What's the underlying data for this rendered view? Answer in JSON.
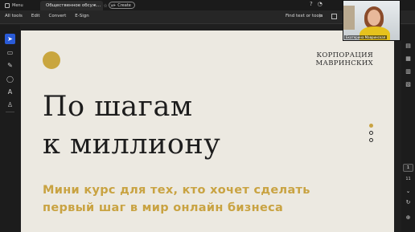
{
  "tabbar": {
    "home_label": "Menu",
    "tab_title": "Общественное обсуж…",
    "tab_close": "×",
    "tab_star": "☆",
    "create_label": "Create",
    "create_plus": "+"
  },
  "menubar": {
    "items": [
      "All tools",
      "Edit",
      "Convert",
      "E-Sign"
    ],
    "find_label": "Find text or tools"
  },
  "document": {
    "corp_line1": "КОРПОРАЦИЯ",
    "corp_line2": "МАВРИНСКИХ",
    "title_line1": "По шагам",
    "title_line2": "к миллиону",
    "subtitle_line1": "Мини курс для тех, кто хочет сделать",
    "subtitle_line2": "первый шаг в мир онлайн бизнеса"
  },
  "navigation": {
    "current_page": "1",
    "total_pages": "11"
  },
  "webcam": {
    "participant_name": "Екатерина Мавринская"
  },
  "colors": {
    "accent_gold": "#c9a342",
    "page_bg": "#ece9e1",
    "active_tool": "#2a5bd7"
  }
}
